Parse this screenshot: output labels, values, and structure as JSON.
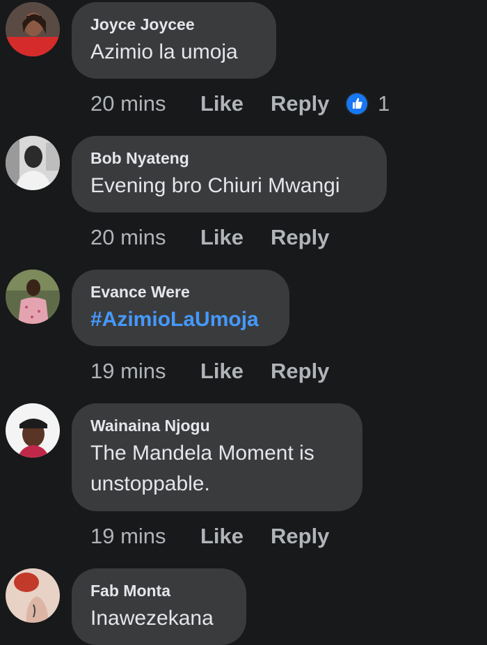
{
  "colors": {
    "background": "#18191a",
    "bubble": "#3a3b3c",
    "text": "#e4e6eb",
    "secondary_text": "#b0b3b8",
    "hashtag": "#4599ff",
    "like_reaction": "#1877f2"
  },
  "comments": [
    {
      "author": "Joyce Joycee",
      "text": "Azimio la umoja",
      "time": "20 mins",
      "like_label": "Like",
      "reply_label": "Reply",
      "reaction_icon": "like-icon",
      "reaction_count": "1"
    },
    {
      "author": "Bob Nyateng",
      "text": "Evening bro Chiuri Mwangi",
      "time": "20 mins",
      "like_label": "Like",
      "reply_label": "Reply"
    },
    {
      "author": "Evance Were",
      "text": "#AzimioLaUmoja",
      "time": "19 mins",
      "like_label": "Like",
      "reply_label": "Reply"
    },
    {
      "author": "Wainaina Njogu",
      "text_line1": "The Mandela Moment is",
      "text_line2": "unstoppable.",
      "time": "19 mins",
      "like_label": "Like",
      "reply_label": "Reply"
    },
    {
      "author": "Fab Monta",
      "text": "Inawezekana"
    }
  ]
}
